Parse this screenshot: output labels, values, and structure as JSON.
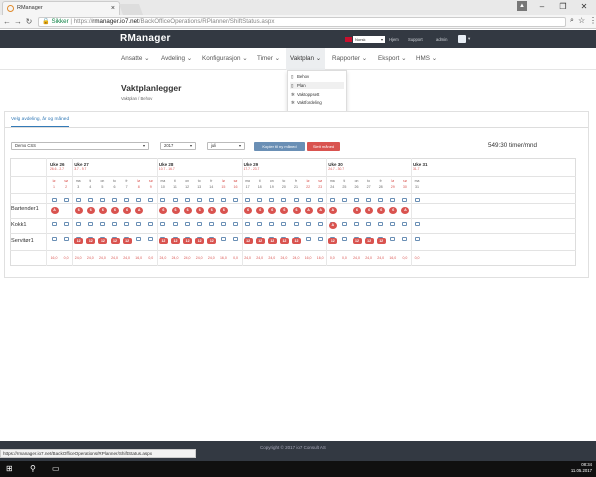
{
  "browser": {
    "tab_title": "RManager",
    "url_secure_label": "Sikker",
    "url_prefix": "https://",
    "url_host": "rmanager.io7.net",
    "url_path": "/BackOfficeOperations/RPlanner/ShiftStatus.aspx",
    "status_url": "https://rmanager.io7.net/BackOfficeOperations/RPlanner/ShiftStatus.aspx"
  },
  "app": {
    "brand": "RManager",
    "language": "Norsk",
    "top_links": [
      "Hjem",
      "Support",
      "admin"
    ]
  },
  "menu": [
    {
      "label": "Ansatte ⌄"
    },
    {
      "label": "Avdeling ⌄"
    },
    {
      "label": "Konfigurasjon ⌄"
    },
    {
      "label": "Timer ⌄"
    },
    {
      "label": "Vaktplan ⌄"
    },
    {
      "label": "Rapporter ⌄"
    },
    {
      "label": "Eksport ⌄"
    },
    {
      "label": "HMS ⌄"
    }
  ],
  "dropdown": [
    {
      "label": "Behov",
      "icon": "page-icon"
    },
    {
      "label": "Plan",
      "icon": "page-icon"
    },
    {
      "label": "Vaktoppsett",
      "icon": "gear-icon"
    },
    {
      "label": "Vaktfordeling",
      "icon": "gear-icon"
    }
  ],
  "page": {
    "title": "Vaktplanlegger",
    "breadcrumb": "Vaktplan / Behov",
    "tab_label": "Velg avdeling, år og måned",
    "dept_select": "Demo CSS",
    "year_select": "2017",
    "month_select": "juli",
    "copy_button": "Kopier til ny måned",
    "delete_button": "Slett måned",
    "hours_total": "549:30 timer/mnd"
  },
  "weeks": [
    {
      "label": "Uke 26",
      "dates": "26.6 - 2.7"
    },
    {
      "label": "Uke 27",
      "dates": "3.7 - 9.7"
    },
    {
      "label": "Uke 28",
      "dates": "10.7 - 16.7"
    },
    {
      "label": "Uke 29",
      "dates": "17.7 - 23.7"
    },
    {
      "label": "Uke 30",
      "dates": "24.7 - 30.7"
    },
    {
      "label": "Uke 31",
      "dates": "31.7"
    }
  ],
  "days": [
    {
      "d": "lø",
      "n": "1",
      "we": true
    },
    {
      "d": "sø",
      "n": "2",
      "we": true
    },
    {
      "d": "ma",
      "n": "3"
    },
    {
      "d": "ti",
      "n": "4"
    },
    {
      "d": "on",
      "n": "5"
    },
    {
      "d": "to",
      "n": "6"
    },
    {
      "d": "fr",
      "n": "7"
    },
    {
      "d": "lø",
      "n": "8",
      "we": true
    },
    {
      "d": "sø",
      "n": "9",
      "we": true
    },
    {
      "d": "ma",
      "n": "10"
    },
    {
      "d": "ti",
      "n": "11"
    },
    {
      "d": "on",
      "n": "12"
    },
    {
      "d": "to",
      "n": "13"
    },
    {
      "d": "fr",
      "n": "14"
    },
    {
      "d": "lø",
      "n": "15",
      "we": true
    },
    {
      "d": "sø",
      "n": "16",
      "we": true
    },
    {
      "d": "ma",
      "n": "17"
    },
    {
      "d": "ti",
      "n": "18"
    },
    {
      "d": "on",
      "n": "19"
    },
    {
      "d": "to",
      "n": "20"
    },
    {
      "d": "fr",
      "n": "21"
    },
    {
      "d": "lø",
      "n": "22",
      "we": true
    },
    {
      "d": "sø",
      "n": "23",
      "we": true
    },
    {
      "d": "ma",
      "n": "24"
    },
    {
      "d": "ti",
      "n": "25"
    },
    {
      "d": "on",
      "n": "26"
    },
    {
      "d": "to",
      "n": "27"
    },
    {
      "d": "fr",
      "n": "28"
    },
    {
      "d": "lø",
      "n": "29",
      "we": true
    },
    {
      "d": "sø",
      "n": "30",
      "we": true
    },
    {
      "d": "ma",
      "n": "31"
    }
  ],
  "rows": [
    {
      "label": "Bartender1",
      "marks": [
        "A",
        "",
        "6",
        "6",
        "6",
        "6",
        "6",
        "A",
        "",
        "6",
        "6",
        "6",
        "6",
        "6",
        "6",
        "",
        "6",
        "6",
        "6",
        "6",
        "6",
        "A",
        "A",
        "A",
        "",
        "6",
        "6",
        "6",
        "6",
        "A",
        ""
      ]
    },
    {
      "label": "Kokk1",
      "marks": [
        "",
        "",
        "",
        "",
        "",
        "",
        "",
        "",
        "",
        "",
        "",
        "",
        "",
        "",
        "",
        "",
        "",
        "",
        "",
        "",
        "",
        "",
        "",
        "A",
        "",
        "",
        "",
        "",
        "",
        "",
        ""
      ]
    },
    {
      "label": "Servitør1",
      "marks": [
        "",
        "",
        "12",
        "12",
        "12",
        "12",
        "12",
        "",
        "",
        "12",
        "12",
        "12",
        "12",
        "12",
        "",
        "",
        "12",
        "12",
        "12",
        "12",
        "12",
        "",
        "",
        "12",
        "",
        "12",
        "12",
        "12",
        "",
        "",
        ""
      ]
    }
  ],
  "totals": [
    "16,0",
    "0,0",
    "24,0",
    "24,0",
    "24,0",
    "24,0",
    "24,0",
    "16,0",
    "0,0",
    "24,0",
    "24,0",
    "24,0",
    "24,0",
    "24,0",
    "16,0",
    "0,0",
    "24,0",
    "24,0",
    "24,0",
    "24,0",
    "24,0",
    "16,0",
    "16,0",
    "0,0",
    "0,0",
    "24,0",
    "24,0",
    "24,0",
    "16,0",
    "0,0",
    "0,0"
  ],
  "footer": {
    "copyright": "Copyright © 2017 io7 Consult AS"
  },
  "taskbar": {
    "time": "08:34",
    "date": "11.05.2017"
  }
}
